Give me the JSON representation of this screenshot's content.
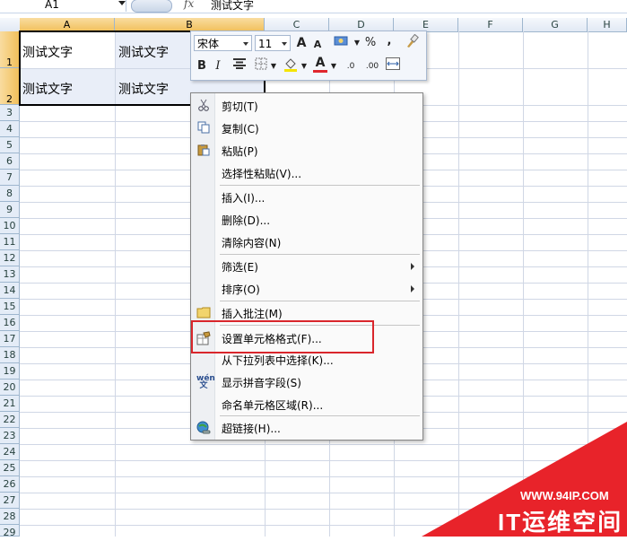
{
  "formula_bar": {
    "name_box": "A1",
    "fx_label": "fx",
    "formula": "测试文字"
  },
  "grid": {
    "columns": [
      "A",
      "B",
      "C",
      "D",
      "E",
      "F",
      "G",
      "H"
    ],
    "rows": [
      "1",
      "2",
      "3",
      "4",
      "5",
      "6",
      "7",
      "8",
      "9",
      "10",
      "11",
      "12",
      "13",
      "14",
      "15",
      "16",
      "17",
      "18",
      "19",
      "20",
      "21",
      "22",
      "23",
      "24",
      "25",
      "26",
      "27",
      "28",
      "29"
    ],
    "cells": {
      "a1": "测试文字",
      "b1": "测试文字",
      "a2": "测试文字",
      "b2": "测试文字"
    }
  },
  "mini_toolbar": {
    "font_name": "宋体",
    "font_size": "11",
    "grow_font": "A",
    "shrink_font": "A",
    "percent": "%",
    "comma": ",",
    "bold": "B",
    "italic": "I",
    "font_color": "A",
    "increase_decimal": ".0",
    "decrease_decimal": ".00"
  },
  "context_menu": {
    "items": [
      {
        "label": "剪切(T)",
        "icon": "scissors-icon"
      },
      {
        "label": "复制(C)",
        "icon": "copy-icon"
      },
      {
        "label": "粘贴(P)",
        "icon": "paste-icon"
      },
      {
        "label": "选择性粘贴(V)...",
        "icon": ""
      },
      {
        "label": "插入(I)...",
        "icon": ""
      },
      {
        "label": "删除(D)...",
        "icon": ""
      },
      {
        "label": "清除内容(N)",
        "icon": ""
      },
      {
        "label": "筛选(E)",
        "icon": "",
        "submenu": true
      },
      {
        "label": "排序(O)",
        "icon": "",
        "submenu": true
      },
      {
        "label": "插入批注(M)",
        "icon": "comment-icon"
      },
      {
        "label": "设置单元格格式(F)...",
        "icon": "format-cells-icon"
      },
      {
        "label": "从下拉列表中选择(K)...",
        "icon": ""
      },
      {
        "label": "显示拼音字段(S)",
        "icon": "phonetic-icon"
      },
      {
        "label": "命名单元格区域(R)...",
        "icon": ""
      },
      {
        "label": "超链接(H)...",
        "icon": "hyperlink-icon"
      }
    ],
    "highlighted_item": "设置单元格格式(F)..."
  },
  "watermark": {
    "url": "WWW.94IP.COM",
    "brand": "IT运维空间"
  },
  "colors": {
    "highlight_border": "#d9262c",
    "watermark": "#e8232a",
    "selected_header": "#f1c05b"
  }
}
